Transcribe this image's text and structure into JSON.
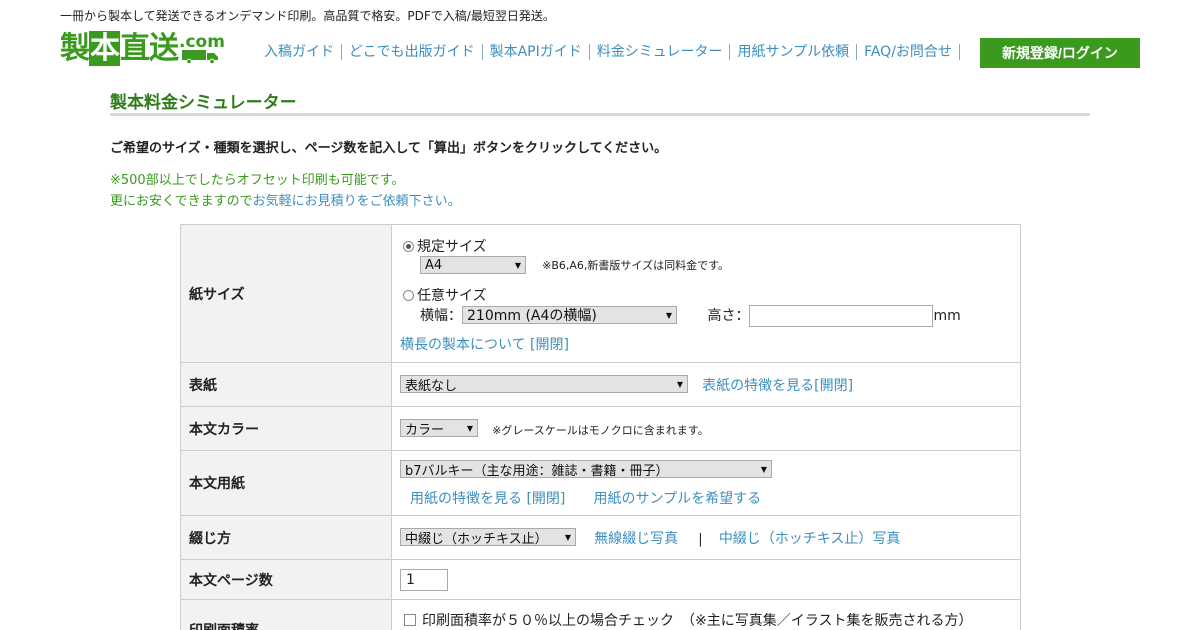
{
  "header": {
    "tagline": "一冊から製本して発送できるオンデマンド印刷。高品質で格安。PDFで入稿/最短翌日発送。",
    "logo_text": "製本直送",
    "logo_hon": "本",
    "logo_com": ".com",
    "nav": [
      {
        "label": "入稿ガイド"
      },
      {
        "label": "どこでも出版ガイド"
      },
      {
        "label": "製本APIガイド"
      },
      {
        "label": "料金シミュレーター"
      },
      {
        "label": "用紙サンプル依頼"
      },
      {
        "label": "FAQ/お問合せ"
      }
    ],
    "login_label": "新規登録/ログイン"
  },
  "page": {
    "title": "製本料金シミュレーター",
    "instruction": "ご希望のサイズ・種類を選択し、ページ数を記入して「算出」ボタンをクリックしてください。",
    "note1": "※500部以上でしたらオフセット印刷も可能です。",
    "note2_prefix": "更にお安くできますので",
    "note2_link": "お気軽にお見積りをご依頼下さい。"
  },
  "form": {
    "paper_size": {
      "label": "紙サイズ",
      "standard_label": "規定サイズ",
      "standard_value": "A4",
      "standard_note": "※B6,A6,新書版サイズは同料金です。",
      "custom_label": "任意サイズ",
      "width_label": "横幅：",
      "width_value": "210mm (A4の横幅)",
      "height_label": "高さ：",
      "height_value": "",
      "unit": "mm",
      "landscape_link": "横長の製本について [開閉]"
    },
    "cover": {
      "label": "表紙",
      "value": "表紙なし",
      "link": "表紙の特徴を見る[開閉]"
    },
    "body_color": {
      "label": "本文カラー",
      "value": "カラー",
      "note": "※グレースケールはモノクロに含まれます。"
    },
    "body_paper": {
      "label": "本文用紙",
      "value": "b7バルキー（主な用途：雑誌・書籍・冊子）",
      "link1": "用紙の特徴を見る [開閉]",
      "link2": "用紙のサンプルを希望する"
    },
    "binding": {
      "label": "綴じ方",
      "value": "中綴じ（ホッチキス止）",
      "link1": "無線綴じ写真",
      "separator": "|",
      "link2": "中綴じ（ホッチキス止）写真"
    },
    "page_count": {
      "label": "本文ページ数",
      "value": "1"
    },
    "print_area": {
      "label": "印刷面積率",
      "checkbox_label": "印刷面積率が５０％以上の場合チェック　（※主に写真集／イラスト集を販売される方）"
    }
  },
  "colors": {
    "brand_green": "#3a9a1e",
    "link_blue": "#3d8fbf"
  }
}
